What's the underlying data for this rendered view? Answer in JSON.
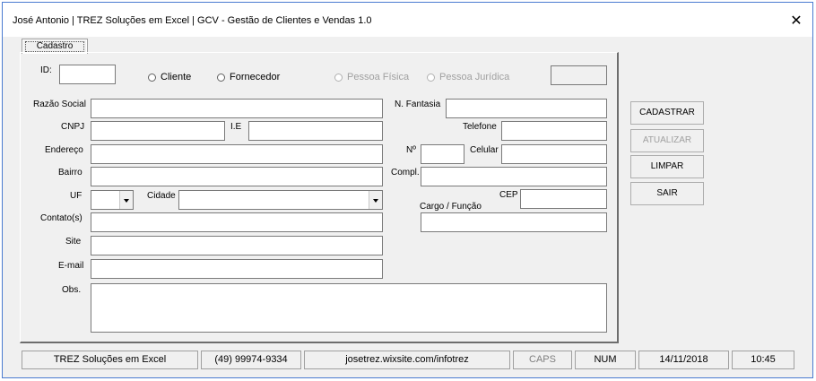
{
  "window": {
    "title": "José Antonio   |   TREZ Soluções em Excel   |   GCV - Gestão de Clientes e Vendas 1.0",
    "close_symbol": "✕"
  },
  "tab": {
    "label": "Cadastro"
  },
  "form": {
    "id_label": "ID:",
    "radio_cliente": "Cliente",
    "radio_fornecedor": "Fornecedor",
    "radio_pessoa_fisica": "Pessoa Física",
    "radio_pessoa_juridica": "Pessoa Jurídica",
    "razao_social_label": "Razão Social",
    "n_fantasia_label": "N. Fantasia",
    "cnpj_label": "CNPJ",
    "ie_label": "I.E",
    "telefone_label": "Telefone",
    "endereco_label": "Endereço",
    "numero_label": "Nº",
    "celular_label": "Celular",
    "bairro_label": "Bairro",
    "compl_label": "Compl.",
    "uf_label": "UF",
    "cidade_label": "Cidade",
    "cep_label": "CEP",
    "cargo_label": "Cargo / Função",
    "contato_label": "Contato(s)",
    "site_label": "Site",
    "email_label": "E-mail",
    "obs_label": "Obs."
  },
  "buttons": {
    "cadastrar": "CADASTRAR",
    "atualizar": "ATUALIZAR",
    "limpar": "LIMPAR",
    "sair": "SAIR"
  },
  "statusbar": {
    "company": "TREZ Soluções em Excel",
    "phone": "(49) 99974-9334",
    "website": "josetrez.wixsite.com/infotrez",
    "caps": "CAPS",
    "num": "NUM",
    "date": "14/11/2018",
    "time": "10:45"
  }
}
